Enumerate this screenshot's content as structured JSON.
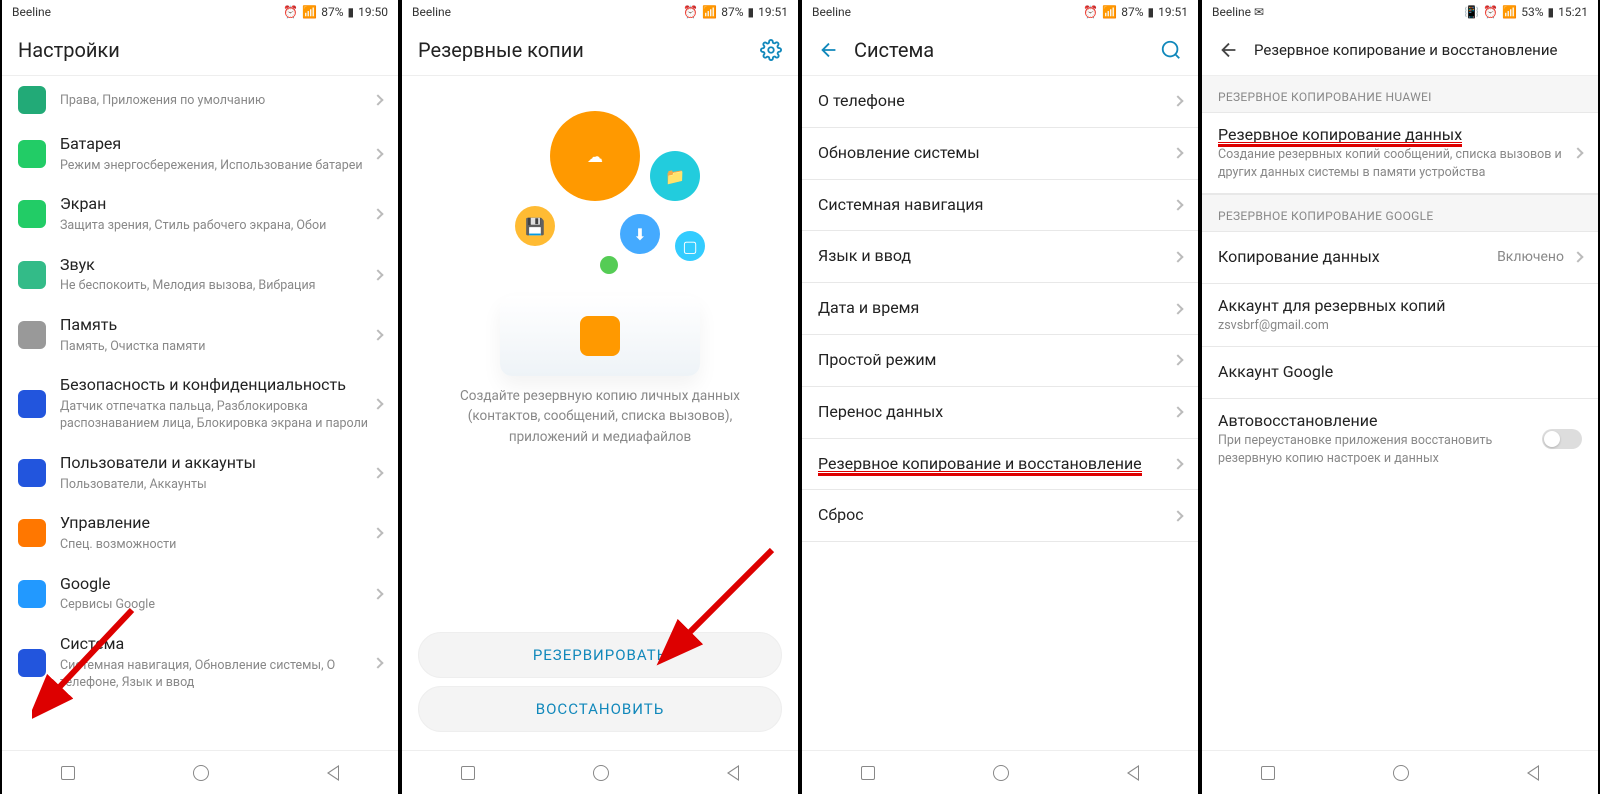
{
  "screens": [
    {
      "status": {
        "carrier": "Beeline",
        "battery": "87%",
        "time": "19:50"
      },
      "header": {
        "title": "Настройки"
      },
      "items": [
        {
          "title": "",
          "sub": "Права, Приложения по умолчанию",
          "color": "#2a7"
        },
        {
          "title": "Батарея",
          "sub": "Режим энергосбережения, Использование батареи",
          "color": "#2c6"
        },
        {
          "title": "Экран",
          "sub": "Защита зрения, Стиль рабочего экрана, Обои",
          "color": "#2c6"
        },
        {
          "title": "Звук",
          "sub": "Не беспокоить, Мелодия вызова, Вибрация",
          "color": "#3b8"
        },
        {
          "title": "Память",
          "sub": "Память, Очистка памяти",
          "color": "#999"
        },
        {
          "title": "Безопасность и конфиденциальность",
          "sub": "Датчик отпечатка пальца, Разблокировка распознаванием лица, Блокировка экрана и пароли",
          "color": "#25d"
        },
        {
          "title": "Пользователи и аккаунты",
          "sub": "Пользователи, Аккаунты",
          "color": "#25d"
        },
        {
          "title": "Управление",
          "sub": "Спец. возможности",
          "color": "#f70"
        },
        {
          "title": "Google",
          "sub": "Сервисы Google",
          "color": "#29f"
        },
        {
          "title": "Система",
          "sub": "Системная навигация, Обновление системы, О телефоне, Язык и ввод",
          "color": "#25d"
        }
      ]
    },
    {
      "status": {
        "carrier": "Beeline",
        "battery": "87%",
        "time": "19:51"
      },
      "header": {
        "title": "Резервные копии"
      },
      "hero_text": "Создайте резервную копию личных данных (контактов, сообщений, списка вызовов), приложений и медиафайлов",
      "btn1": "РЕЗЕРВИРОВАТЬ",
      "btn2": "ВОССТАНОВИТЬ"
    },
    {
      "status": {
        "carrier": "Beeline",
        "battery": "87%",
        "time": "19:51"
      },
      "header": {
        "title": "Система"
      },
      "items": [
        "О телефоне",
        "Обновление системы",
        "Системная навигация",
        "Язык и ввод",
        "Дата и время",
        "Простой режим",
        "Перенос данных",
        "Резервное копирование и восстановление",
        "Сброс"
      ]
    },
    {
      "status": {
        "carrier": "Beeline",
        "battery": "53%",
        "time": "15:21"
      },
      "header": {
        "title": "Резервное копирование и восстановление"
      },
      "section1": "РЕЗЕРВНОЕ КОПИРОВАНИЕ HUAWEI",
      "item1": {
        "title": "Резервное копирование данных",
        "sub": "Создание резервных копий сообщений, списка вызовов и других данных системы в памяти устройства"
      },
      "section2": "РЕЗЕРВНОЕ КОПИРОВАНИЕ GOOGLE",
      "item2": {
        "title": "Копирование данных",
        "value": "Включено"
      },
      "item3": {
        "title": "Аккаунт для резервных копий",
        "sub": "zsvsbrf@gmail.com"
      },
      "item4": {
        "title": "Аккаунт Google"
      },
      "item5": {
        "title": "Автовосстановление",
        "sub": "При переустановке приложения восстановить резервную копию настроек и данных"
      }
    }
  ],
  "status4": {
    "carrier": "Beeline",
    "battery": "53%",
    "time": "15:21"
  }
}
